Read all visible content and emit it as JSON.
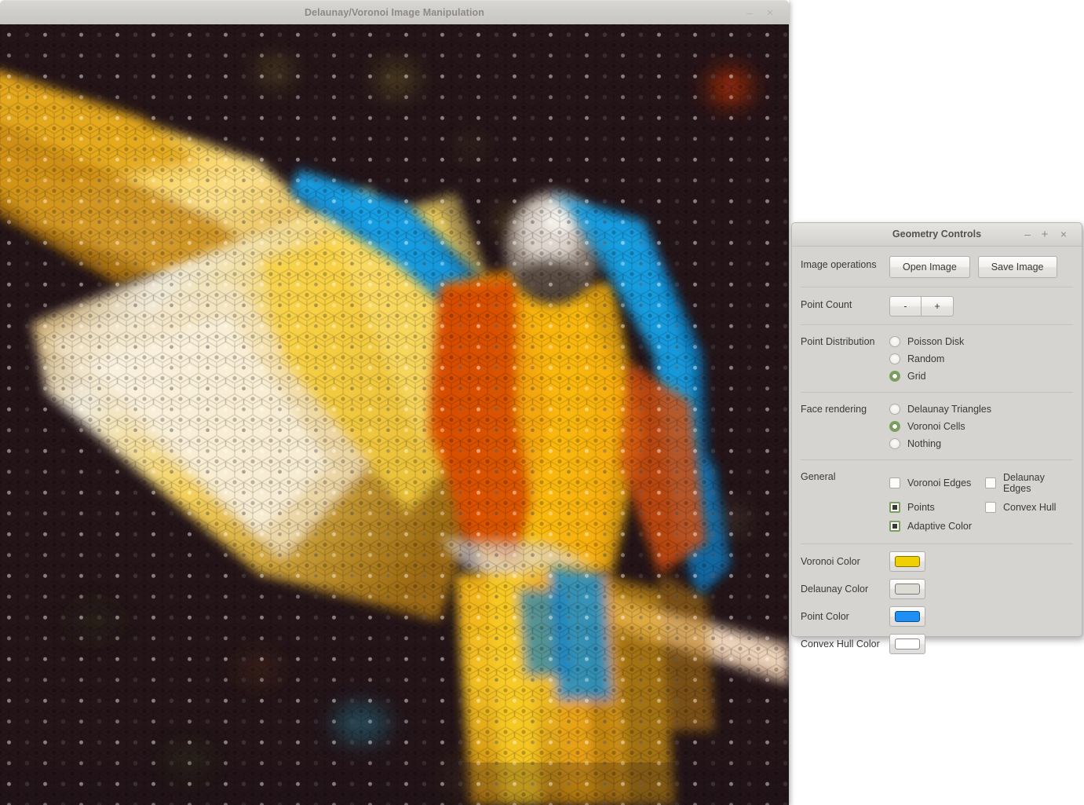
{
  "main_window": {
    "title": "Delaunay/Voronoi Image Manipulation",
    "minimize_label": "–",
    "close_label": "×",
    "canvas_description": "Voronoi hexagonal cell rendering of a blue-and-gold macaw with spread wings on a dark maroon background, with point dots drawn in each cell",
    "background_color": "#1d1116"
  },
  "panel": {
    "title": "Geometry Controls",
    "minimize_label": "–",
    "maximize_label": "+",
    "close_label": "×",
    "image_operations": {
      "label": "Image operations",
      "open_label": "Open Image",
      "save_label": "Save Image"
    },
    "point_count": {
      "label": "Point Count",
      "decrement_label": "-",
      "increment_label": "+"
    },
    "point_distribution": {
      "label": "Point Distribution",
      "options": [
        {
          "label": "Poisson Disk",
          "selected": false
        },
        {
          "label": "Random",
          "selected": false
        },
        {
          "label": "Grid",
          "selected": true
        }
      ]
    },
    "face_rendering": {
      "label": "Face rendering",
      "options": [
        {
          "label": "Delaunay Triangles",
          "selected": false
        },
        {
          "label": "Voronoi Cells",
          "selected": true
        },
        {
          "label": "Nothing",
          "selected": false
        }
      ]
    },
    "general": {
      "label": "General",
      "checkboxes": [
        {
          "label": "Voronoi Edges",
          "checked": false
        },
        {
          "label": "Delaunay Edges",
          "checked": false
        },
        {
          "label": "Points",
          "checked": true
        },
        {
          "label": "Convex Hull",
          "checked": false
        },
        {
          "label": "Adaptive Color",
          "checked": true
        }
      ]
    },
    "colors": [
      {
        "label": "Voronoi Color",
        "value": "#efd000"
      },
      {
        "label": "Delaunay Color",
        "value": "#dcdcd4"
      },
      {
        "label": "Point Color",
        "value": "#1e90f5"
      },
      {
        "label": "Convex Hull Color",
        "value": "#ffffff"
      }
    ],
    "accent_color": "#7ba05b",
    "panel_background": "#d6d4d1"
  }
}
